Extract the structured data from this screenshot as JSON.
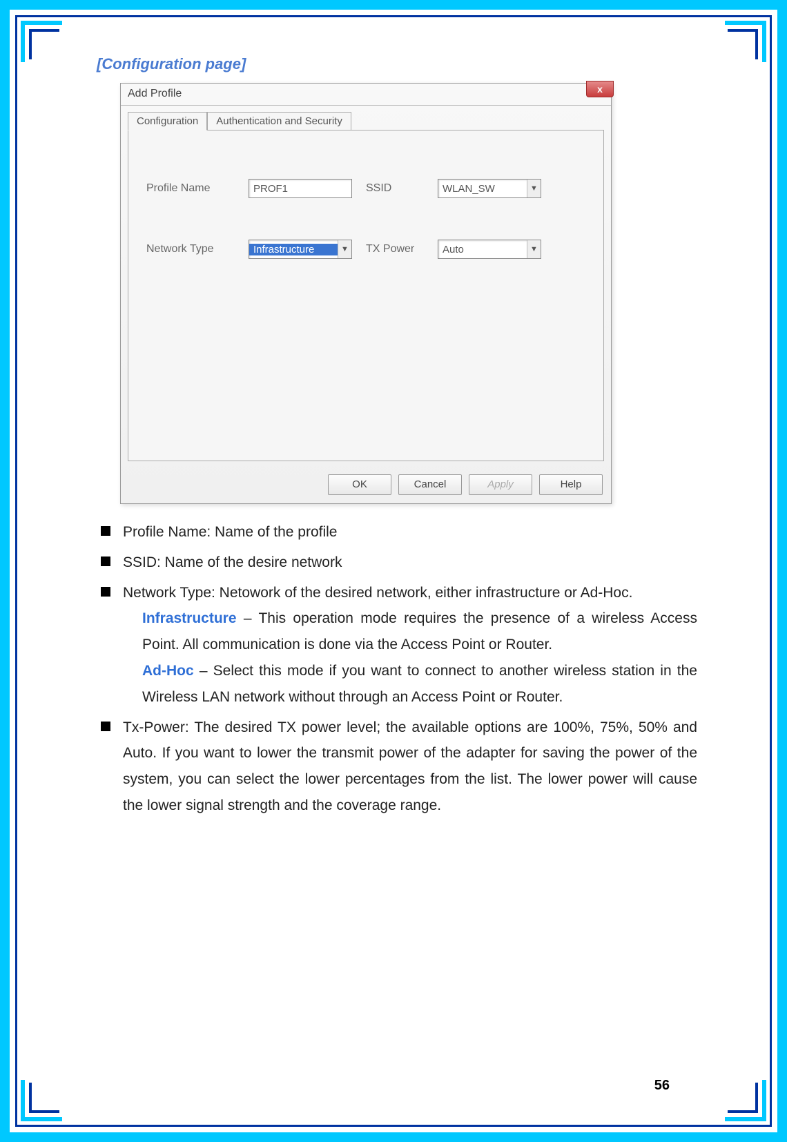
{
  "page": {
    "section_title": "[Configuration page]",
    "page_number": "56"
  },
  "dialog": {
    "title": "Add Profile",
    "close_label": "x",
    "tabs": {
      "configuration": "Configuration",
      "auth": "Authentication and Security"
    },
    "labels": {
      "profile_name": "Profile Name",
      "ssid": "SSID",
      "network_type": "Network Type",
      "tx_power": "TX Power"
    },
    "values": {
      "profile_name": "PROF1",
      "ssid": "WLAN_SW",
      "network_type": "Infrastructure",
      "tx_power": "Auto"
    },
    "buttons": {
      "ok": "OK",
      "cancel": "Cancel",
      "apply": "Apply",
      "help": "Help"
    }
  },
  "desc": {
    "b1": "Profile Name: Name of the profile",
    "b2": "SSID: Name of the desire network",
    "b3": "Network Type: Netowork of the desired network, either infrastructure or Ad-Hoc.",
    "b3_infra_kw": "Infrastructure",
    "b3_infra": " – This operation mode requires the presence of a wireless Access Point. All communication is done via the Access Point or Router.",
    "b3_adhoc_kw": "Ad-Hoc",
    "b3_adhoc": " – Select this mode if you want to connect to another wireless station in the Wireless LAN network without through an Access Point or Router.",
    "b4": "Tx-Power: The desired TX power level; the available options are 100%, 75%, 50% and Auto. If you want to lower the transmit power of the adapter for saving the power of the system, you can select the lower percentages from the list. The lower power will cause the lower signal strength and the coverage range."
  }
}
